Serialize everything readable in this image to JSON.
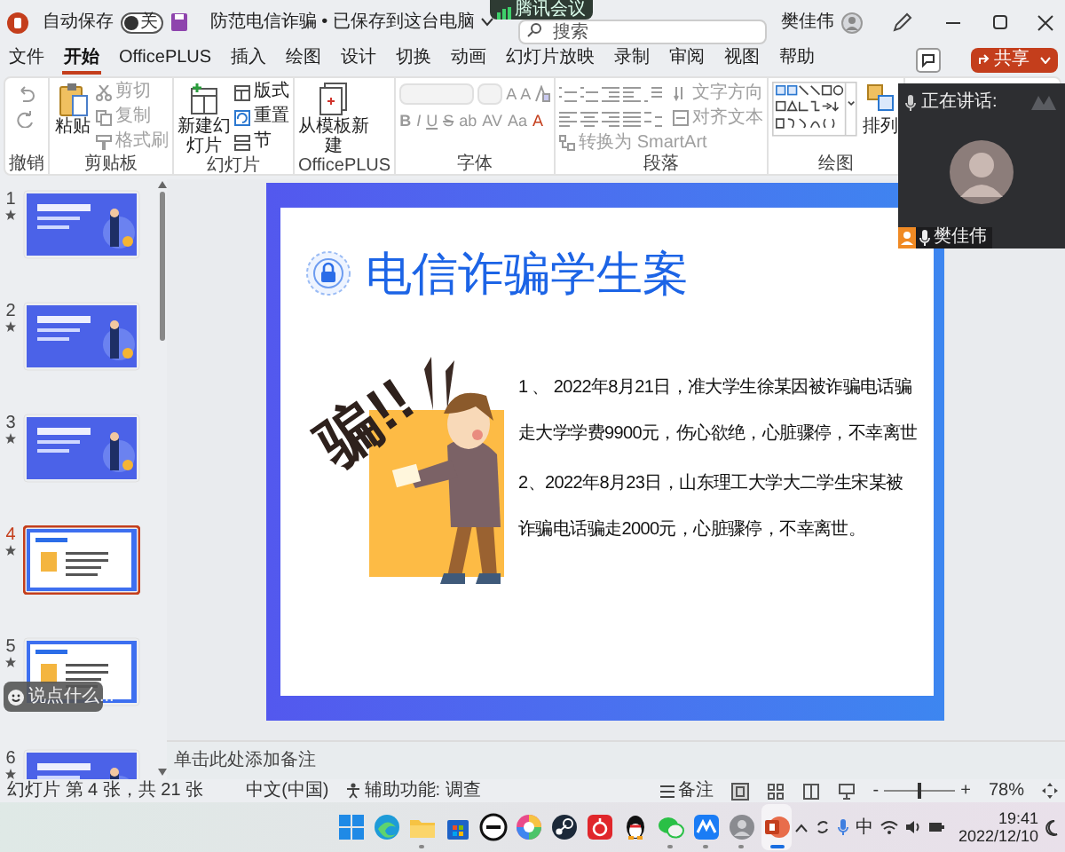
{
  "title_bar": {
    "autosave_label": "自动保存",
    "autosave_toggle": {
      "label": "关",
      "on": false
    },
    "document_title": "防范电信诈骗 • 已保存到这台电脑",
    "search_placeholder": "搜索",
    "user_name": "樊佳伟"
  },
  "meeting_badge": "腾讯会议",
  "menu_tabs": [
    {
      "label": "文件",
      "selected": false
    },
    {
      "label": "开始",
      "selected": true
    },
    {
      "label": "OfficePLUS",
      "selected": false
    },
    {
      "label": "插入",
      "selected": false
    },
    {
      "label": "绘图",
      "selected": false
    },
    {
      "label": "设计",
      "selected": false
    },
    {
      "label": "切换",
      "selected": false
    },
    {
      "label": "动画",
      "selected": false
    },
    {
      "label": "幻灯片放映",
      "selected": false
    },
    {
      "label": "录制",
      "selected": false
    },
    {
      "label": "审阅",
      "selected": false
    },
    {
      "label": "视图",
      "selected": false
    },
    {
      "label": "帮助",
      "selected": false
    }
  ],
  "share_button": "共享",
  "ribbon": [
    {
      "kind": "undo",
      "label": "撤销"
    },
    {
      "kind": "clipboard",
      "label": "剪贴板",
      "large": {
        "label": "粘贴",
        "disabled": false
      },
      "small": [
        {
          "label": "剪切",
          "disabled": true
        },
        {
          "label": "复制",
          "disabled": true
        },
        {
          "label": "格式刷",
          "disabled": true
        }
      ]
    },
    {
      "kind": "slides",
      "label": "幻灯片",
      "large": {
        "label": "新建幻灯片",
        "disabled": false
      },
      "small": [
        {
          "label": "版式",
          "disabled": false
        },
        {
          "label": "重置",
          "disabled": false
        },
        {
          "label": "节",
          "disabled": false
        }
      ]
    },
    {
      "kind": "officeplus",
      "label": "OfficePLUS",
      "large": {
        "label": "从模板新建",
        "disabled": false
      }
    },
    {
      "kind": "font",
      "label": "字体",
      "size_buttons": [
        "A",
        "A"
      ],
      "format_buttons": [
        "B",
        "I",
        "U",
        "S",
        "ab",
        "AV",
        "Aa",
        "A"
      ]
    },
    {
      "kind": "paragraph",
      "label": "段落",
      "small": [
        {
          "label": "文字方向",
          "disabled": true
        },
        {
          "label": "对齐文本",
          "disabled": true
        },
        {
          "label": "转换为 SmartArt",
          "disabled": true
        }
      ]
    },
    {
      "kind": "drawing",
      "label": "绘图",
      "large": {
        "label": "排列",
        "disabled": false
      }
    }
  ],
  "meeting_panel": {
    "status": "正在讲话:",
    "speaker": "樊佳伟"
  },
  "thumbnails": [
    {
      "number": "1",
      "kind": "blue",
      "selected": false
    },
    {
      "number": "2",
      "kind": "blue",
      "selected": false
    },
    {
      "number": "3",
      "kind": "blue",
      "selected": false
    },
    {
      "number": "4",
      "kind": "white",
      "selected": true
    },
    {
      "number": "5",
      "kind": "white",
      "selected": false
    },
    {
      "number": "6",
      "kind": "blue",
      "selected": false
    }
  ],
  "chat_bubble": "说点什么...",
  "slide": {
    "title": "电信诈骗学生案",
    "illustration_text": "骗!!",
    "paragraphs": [
      {
        "lines": [
          "1 、 2022年8月21日，准大学生徐某因被诈骗电话骗",
          "走大学学费9900元，伤心欲绝，心脏骤停，不幸离世"
        ]
      },
      {
        "lines": [
          "2、2022年8月23日，山东理工大学大二学生宋某被",
          "诈骗电话骗走2000元，心脏骤停，不幸离世。"
        ]
      }
    ]
  },
  "notes_placeholder": "单击此处添加备注",
  "status_bar": {
    "slide_info": "幻灯片 第 4 张，共 21 张",
    "language": "中文(中国)",
    "accessibility": "辅助功能: 调查",
    "notes_button": "备注",
    "zoom_out": "-",
    "zoom_in": "+",
    "zoom": {
      "level": 0.5
    },
    "zoom_percent": "78%"
  },
  "taskbar": {
    "apps": [
      {
        "kind": "start",
        "running": false
      },
      {
        "kind": "edge",
        "running": false
      },
      {
        "kind": "folder",
        "running": true
      },
      {
        "kind": "store",
        "running": false
      },
      {
        "kind": "dell",
        "running": false
      },
      {
        "kind": "wheel",
        "running": false
      },
      {
        "kind": "steam",
        "running": false
      },
      {
        "kind": "music",
        "running": false
      },
      {
        "kind": "penguin",
        "running": false
      },
      {
        "kind": "chat",
        "running": true
      },
      {
        "kind": "meeting",
        "running": true
      },
      {
        "kind": "avatar",
        "running": true
      },
      {
        "kind": "powerpoint",
        "running": true
      }
    ],
    "input_method": "中",
    "time": "19:41",
    "date": "2022/12/10"
  }
}
